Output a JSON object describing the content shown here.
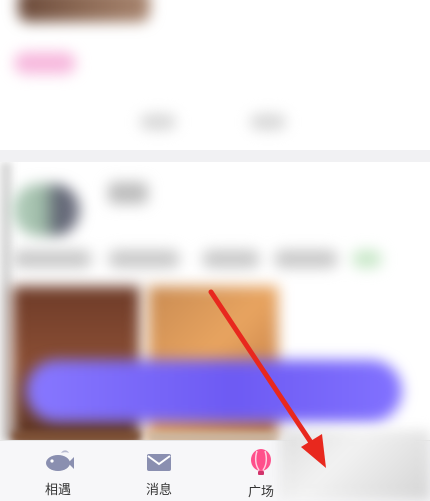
{
  "colors": {
    "accent_pink": "#ff4f8b",
    "banner_purple": "#6d5af3",
    "arrow_red": "#e8281e"
  },
  "tabbar": {
    "tabs": [
      {
        "label": "相遇",
        "icon": "fish-icon"
      },
      {
        "label": "消息",
        "icon": "message-icon"
      },
      {
        "label": "广场",
        "icon": "balloon-icon"
      }
    ]
  }
}
